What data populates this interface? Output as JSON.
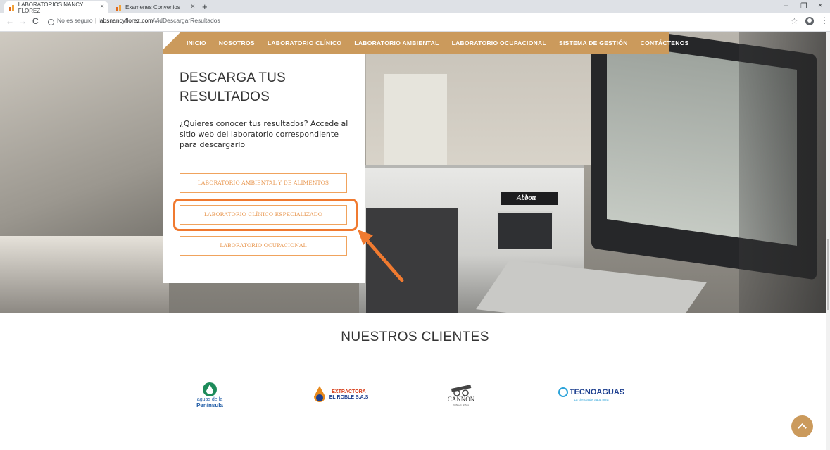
{
  "browser": {
    "tabs": [
      {
        "title": "LABORATORIOS NANCY FLOREZ",
        "close": "×"
      },
      {
        "title": "Examenes Convenios",
        "close": "×"
      }
    ],
    "new_tab": "+",
    "window_controls": {
      "minimize": "–",
      "restore": "❐",
      "close": "×"
    },
    "nav": {
      "back": "←",
      "forward": "→",
      "reload": "C"
    },
    "url": {
      "security": "No es seguro",
      "separator": "|",
      "host": "labsnancyflorez.com",
      "path": "/#idDescargarResultados"
    },
    "bookmark_icon": "☆",
    "menu_icon": "⋮"
  },
  "navbar": {
    "items": [
      "INICIO",
      "NOSOTROS",
      "LABORATORIO CLÍNICO",
      "LABORATORIO AMBIENTAL",
      "LABORATORIO OCUPACIONAL",
      "SISTEMA DE GESTIÓN",
      "CONTÁCTENOS"
    ],
    "color": "#cb9a5c"
  },
  "hero": {
    "machine_brand": "Abbott"
  },
  "card": {
    "title_line1": "DESCARGA TUS",
    "title_line2": "RESULTADOS",
    "description": "¿Quieres conocer tus resultados? Accede al sitio web del laboratorio correspondiente para descargarlo",
    "buttons": [
      "LABORATORIO AMBIENTAL Y DE ALIMENTOS",
      "LABORATORIO CLÍNICO ESPECIALIZADO",
      "LABORATORIO OCUPACIONAL"
    ],
    "accent": "#f0a35d"
  },
  "annotation": {
    "color": "#f07a30"
  },
  "clients": {
    "title": "NUESTROS CLIENTES",
    "logos": [
      {
        "line1": "aguas de la",
        "line2": "Península",
        "icon": "water-drop-icon"
      },
      {
        "line1": "EXTRACTORA",
        "line2": "EL ROBLE S.A.S",
        "icon": "oil-drop-icon"
      },
      {
        "line1": "CANNON",
        "line2": "SINCE 1901",
        "icon": "cannon-icon"
      },
      {
        "line1": "TECNOAGUAS",
        "line2": "La ciencia del agua pura",
        "icon": "drop-icon"
      }
    ]
  },
  "scroll_top_icon": "chevron-up-icon"
}
